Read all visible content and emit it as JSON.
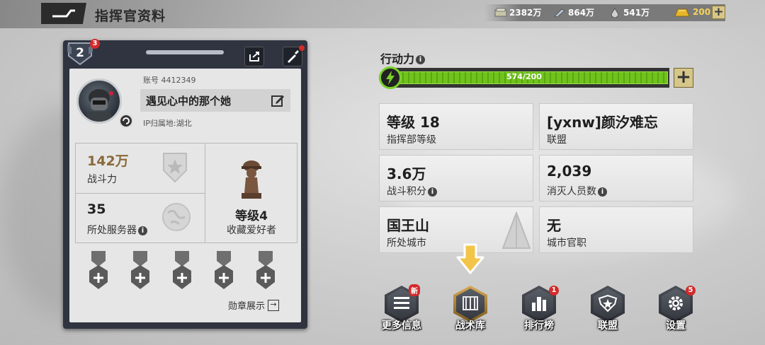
{
  "header": {
    "title": "指挥官资料",
    "resources": [
      {
        "icon": "cash-icon",
        "value": "2382万"
      },
      {
        "icon": "steel-icon",
        "value": "864万"
      },
      {
        "icon": "oil-icon",
        "value": "541万"
      },
      {
        "icon": "gold-icon",
        "value": "200"
      }
    ]
  },
  "profile": {
    "rank_level": "2",
    "rank_notif": "3",
    "account_label": "账号 4412349",
    "name": "遇见心中的那个她",
    "ip_location": "IP归属地:湖北",
    "combat_power_value": "142万",
    "combat_power_label": "战斗力",
    "server_value": "35",
    "server_label": "所处服务器",
    "collector_value": "等级4",
    "collector_label": "收藏爱好者",
    "medal_show_label": "勋章展示"
  },
  "action_points": {
    "label": "行动力",
    "text": "574/200",
    "fill_fraction": 1.0
  },
  "tiles": [
    {
      "value": "等级 18",
      "label": "指挥部等级",
      "info": false
    },
    {
      "value": "[yxnw]颜汐难忘",
      "label": "联盟",
      "info": false
    },
    {
      "value": "3.6万",
      "label": "战斗积分",
      "info": true
    },
    {
      "value": "2,039",
      "label": "消灭人员数",
      "info": true
    },
    {
      "value": "国王山",
      "label": "所处城市",
      "info": false
    },
    {
      "value": "无",
      "label": "城市官职",
      "info": false
    }
  ],
  "nav": [
    {
      "label": "更多信息",
      "badge": "新",
      "icon": "menu-icon"
    },
    {
      "label": "战术库",
      "badge": "",
      "icon": "tactics-icon"
    },
    {
      "label": "排行榜",
      "badge": "1",
      "icon": "ranking-icon"
    },
    {
      "label": "联盟",
      "badge": "",
      "icon": "alliance-icon"
    },
    {
      "label": "设置",
      "badge": "5",
      "icon": "settings-icon"
    }
  ],
  "colors": {
    "accent_green": "#6fc31c",
    "gold": "#d6c68a",
    "badge_red": "#d42a2a"
  }
}
